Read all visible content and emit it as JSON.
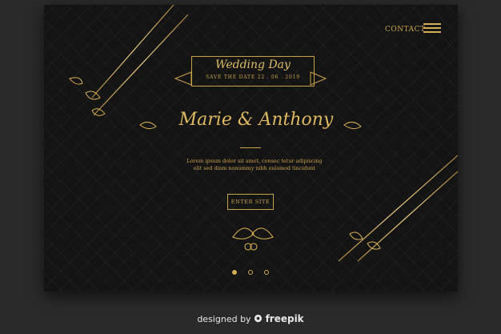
{
  "nav": {
    "contact_label": "CONTACT",
    "menu_icon": "hamburger-menu-icon"
  },
  "banner": {
    "title": "Wedding Day",
    "subtitle": "SAVE THE DATE   22 . 06 . 2019"
  },
  "hero": {
    "couple_names": "Marie & Anthony",
    "body_line1": "Lorem ipsum dolor sit amet, consec tetur adipiscing",
    "body_line2": "elit sed diam nonummy nibh euismod tincidunt",
    "enter_label": "ENTER SITE"
  },
  "carousel": {
    "total": 3,
    "active_index": 0
  },
  "footer": {
    "credit_prefix": "designed by",
    "brand": "freepik"
  },
  "colors": {
    "gold": "#d4ae55",
    "card": "#141414",
    "page": "#2a2a2a"
  },
  "icons": [
    "hamburger-menu-icon",
    "leaf-left-icon",
    "leaf-right-icon",
    "rings-icon",
    "freepik-logo-icon"
  ]
}
